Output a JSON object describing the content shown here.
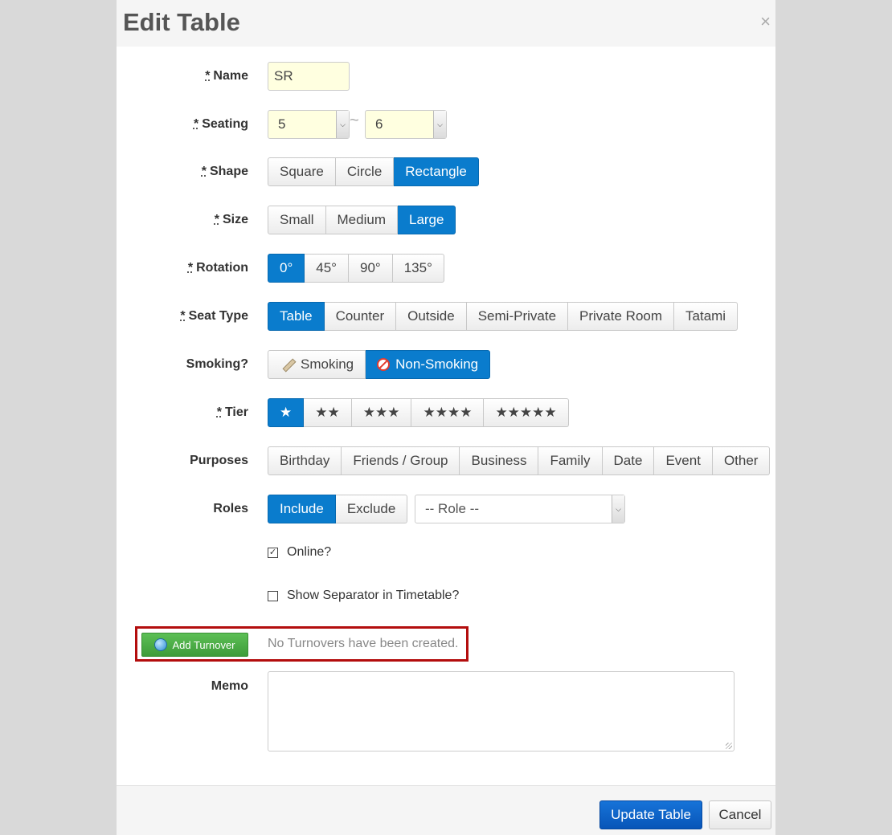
{
  "dialog": {
    "title": "Edit Table",
    "close_glyph": "×"
  },
  "form": {
    "required_mark": "*",
    "name": {
      "label": "Name",
      "value": "SR"
    },
    "seating": {
      "label": "Seating",
      "min": "5",
      "max": "6",
      "separator": "~"
    },
    "shape": {
      "label": "Shape",
      "options": [
        "Square",
        "Circle",
        "Rectangle"
      ],
      "selected": "Rectangle"
    },
    "size": {
      "label": "Size",
      "options": [
        "Small",
        "Medium",
        "Large"
      ],
      "selected": "Large"
    },
    "rotation": {
      "label": "Rotation",
      "options": [
        "0°",
        "45°",
        "90°",
        "135°"
      ],
      "selected": "0°"
    },
    "seat_type": {
      "label": "Seat Type",
      "options": [
        "Table",
        "Counter",
        "Outside",
        "Semi-Private",
        "Private Room",
        "Tatami"
      ],
      "selected": "Table"
    },
    "smoking": {
      "label": "Smoking?",
      "options": [
        "Smoking",
        "Non-Smoking"
      ],
      "selected": "Non-Smoking"
    },
    "tier": {
      "label": "Tier",
      "options": [
        "★",
        "★★",
        "★★★",
        "★★★★",
        "★★★★★"
      ],
      "selected": "★"
    },
    "purposes": {
      "label": "Purposes",
      "options": [
        "Birthday",
        "Friends / Group",
        "Business",
        "Family",
        "Date",
        "Event",
        "Other"
      ]
    },
    "roles": {
      "label": "Roles",
      "options": [
        "Include",
        "Exclude"
      ],
      "selected": "Include",
      "role_placeholder": "-- Role --"
    },
    "online": {
      "label": "Online?",
      "checked": true
    },
    "separator": {
      "label": "Show Separator in Timetable?",
      "checked": false
    },
    "turnover": {
      "button_label": "Add Turnover",
      "empty_text": "No Turnovers have been created."
    },
    "memo": {
      "label": "Memo",
      "value": ""
    }
  },
  "footer": {
    "update_label": "Update Table",
    "cancel_label": "Cancel"
  },
  "colors": {
    "active": "#0a7ccd",
    "primary": "#0a5fc4",
    "highlight_border": "#b30d0d",
    "add_button": "#4cae47",
    "input_bg": "#ffffe0"
  }
}
